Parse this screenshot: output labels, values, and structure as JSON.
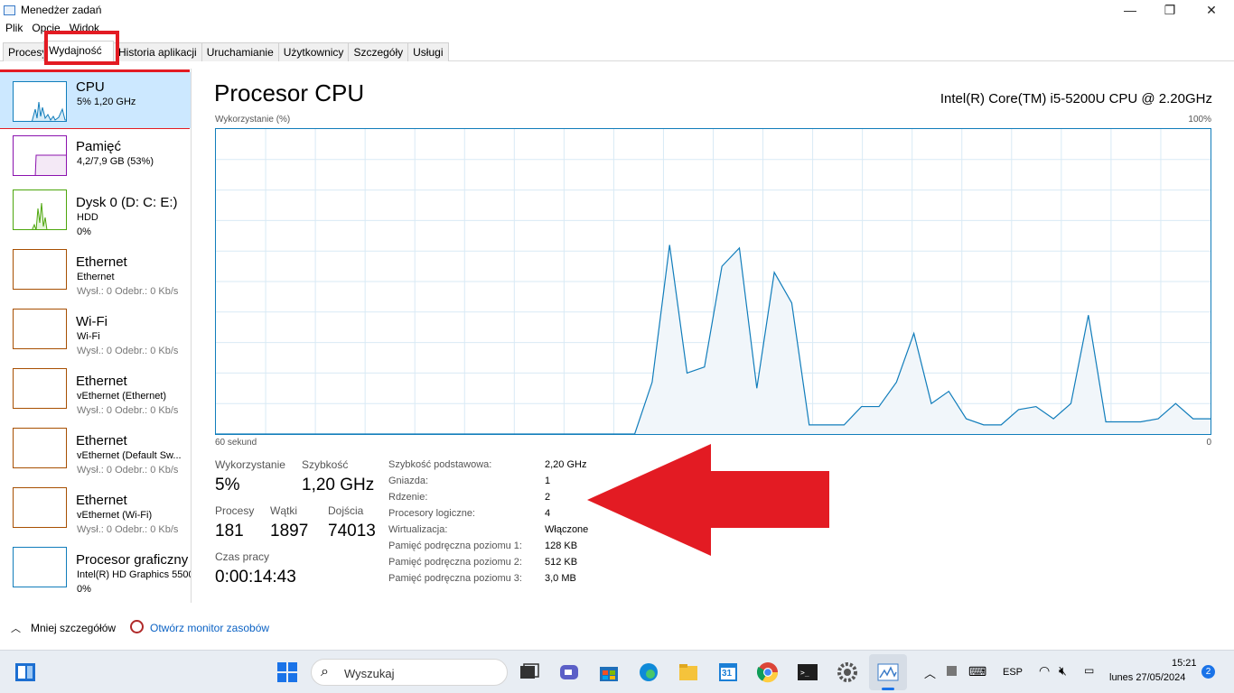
{
  "window": {
    "title": "Menedżer zadań"
  },
  "menu": [
    "Plik",
    "Opcje",
    "Widok"
  ],
  "tabs": [
    "Procesy",
    "Wydajność",
    "Historia aplikacji",
    "Uruchamianie",
    "Użytkownicy",
    "Szczegóły",
    "Usługi"
  ],
  "active_tab": "Wydajność",
  "sidebar": {
    "items": [
      {
        "title": "CPU",
        "sub": "5%  1,20 GHz",
        "sub2": "",
        "color": "#117dbb"
      },
      {
        "title": "Pamięć",
        "sub": "4,2/7,9 GB (53%)",
        "sub2": "",
        "color": "#8b12ae"
      },
      {
        "title": "Dysk 0 (D: C: E:)",
        "sub": "HDD",
        "sub2": "0%",
        "color": "#4da60c"
      },
      {
        "title": "Ethernet",
        "sub": "Ethernet",
        "sub2": "Wysł.: 0  Odebr.: 0 Kb/s",
        "color": "#a74f01"
      },
      {
        "title": "Wi-Fi",
        "sub": "Wi-Fi",
        "sub2": "Wysł.: 0  Odebr.: 0 Kb/s",
        "color": "#a74f01"
      },
      {
        "title": "Ethernet",
        "sub": "vEthernet (Ethernet)",
        "sub2": "Wysł.: 0  Odebr.: 0 Kb/s",
        "color": "#a74f01"
      },
      {
        "title": "Ethernet",
        "sub": "vEthernet (Default Sw...",
        "sub2": "Wysł.: 0  Odebr.: 0 Kb/s",
        "color": "#a74f01"
      },
      {
        "title": "Ethernet",
        "sub": "vEthernet (Wi-Fi)",
        "sub2": "Wysł.: 0  Odebr.: 0 Kb/s",
        "color": "#a74f01"
      },
      {
        "title": "Procesor graficzny",
        "sub": "Intel(R) HD Graphics 5500",
        "sub2": "0%",
        "color": "#117dbb"
      }
    ]
  },
  "main": {
    "title": "Procesor CPU",
    "model": "Intel(R) Core(TM) i5-5200U CPU @ 2.20GHz",
    "graph_label": "Wykorzystanie (%)",
    "graph_max": "100%",
    "graph_time": "60 sekund",
    "graph_min": "0",
    "usage_series": [
      0,
      0,
      0,
      0,
      0,
      0,
      0,
      0,
      0,
      0,
      0,
      0,
      0,
      0,
      0,
      0,
      0,
      0,
      0,
      0,
      0,
      0,
      0,
      0,
      0,
      17,
      62,
      20,
      22,
      55,
      61,
      15,
      53,
      43,
      3,
      3,
      3,
      9,
      9,
      17,
      33,
      10,
      14,
      5,
      3,
      3,
      8,
      9,
      5,
      10,
      39,
      4,
      4,
      4,
      5,
      10,
      5,
      5
    ],
    "stats": {
      "usage_label": "Wykorzystanie",
      "usage_value": "5%",
      "speed_label": "Szybkość",
      "speed_value": "1,20 GHz",
      "processes_label": "Procesy",
      "processes_value": "181",
      "threads_label": "Wątki",
      "threads_value": "1897",
      "handles_label": "Dojścia",
      "handles_value": "74013",
      "uptime_label": "Czas pracy",
      "uptime_value": "0:00:14:43"
    },
    "info": [
      {
        "label": "Szybkość podstawowa:",
        "value": "2,20 GHz"
      },
      {
        "label": "Gniazda:",
        "value": "1"
      },
      {
        "label": "Rdzenie:",
        "value": "2"
      },
      {
        "label": "Procesory logiczne:",
        "value": "4"
      },
      {
        "label": "Wirtualizacja:",
        "value": "Włączone"
      },
      {
        "label": "Pamięć podręczna poziomu 1:",
        "value": "128 KB"
      },
      {
        "label": "Pamięć podręczna poziomu 2:",
        "value": "512 KB"
      },
      {
        "label": "Pamięć podręczna poziomu 3:",
        "value": "3,0 MB"
      }
    ]
  },
  "footer": {
    "less_details": "Mniej szczegółów",
    "resource_monitor": "Otwórz monitor zasobów"
  },
  "taskbar": {
    "search_placeholder": "Wyszukaj",
    "language": "ESP",
    "time": "15:21",
    "date": "lunes 27/05/2024",
    "notifications": "2",
    "calendar_day": "31"
  },
  "annotation_color": "#e31b23"
}
